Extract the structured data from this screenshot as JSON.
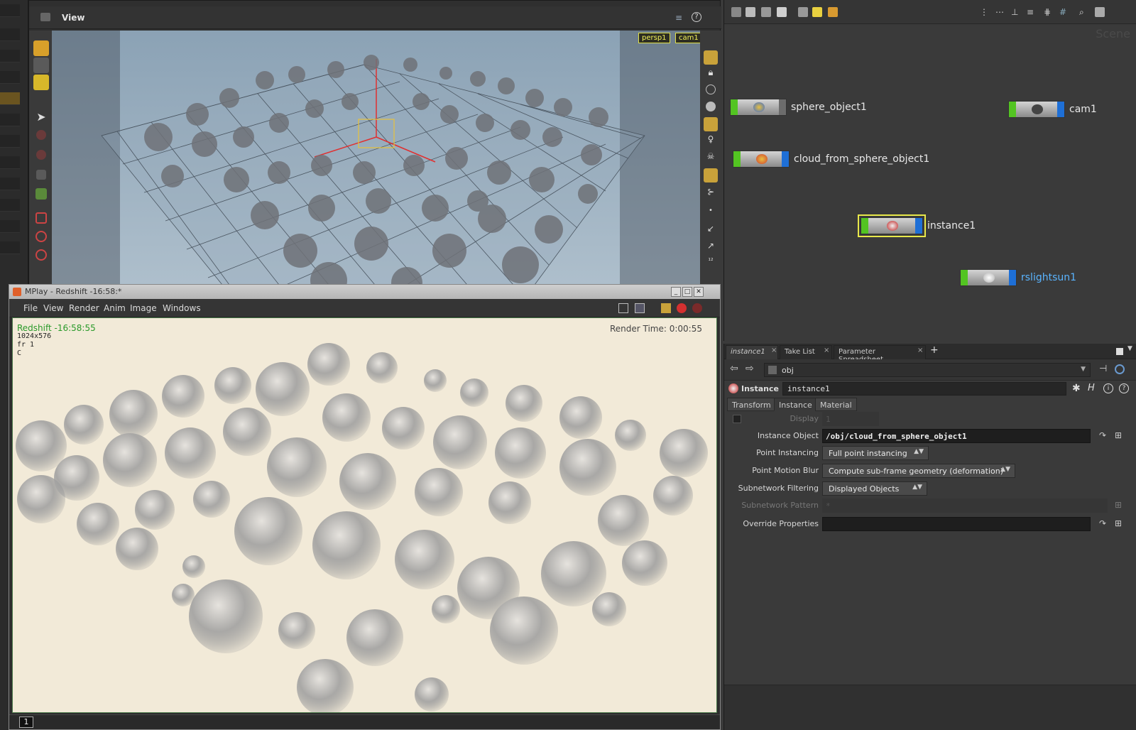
{
  "viewer": {
    "title": "View",
    "camera_menu": "persp1",
    "view_menu": "cam1"
  },
  "mplay": {
    "window_title": "MPlay - Redshift -16:58:*",
    "menus": [
      "File",
      "View",
      "Render",
      "Anim",
      "Image",
      "Windows"
    ],
    "render_name": "Redshift -16:58:55",
    "resolution": "1024x576",
    "frame_info": "fr 1",
    "channel": "C",
    "render_time": "Render Time: 0:00:55",
    "frame_number": "1",
    "window_buttons": [
      "_",
      "□",
      "✕"
    ]
  },
  "network": {
    "watermark": "Scene",
    "nodes": [
      {
        "name": "sphere_object1",
        "icon": "sphere-object-icon",
        "output_color": "#6c6c6c"
      },
      {
        "name": "cam1",
        "icon": "camera-icon",
        "output_color": "#1e6fd6"
      },
      {
        "name": "cloud_from_sphere_object1",
        "icon": "cloud-object-icon",
        "output_color": "#1e6fd6"
      },
      {
        "name": "instance1",
        "icon": "instance-icon",
        "output_color": "#1e6fd6",
        "selected": true
      },
      {
        "name": "rslightsun1",
        "icon": "sun-light-icon",
        "output_color": "#1e6fd6",
        "label_color": "#5ab4ff"
      }
    ]
  },
  "params": {
    "pane_tabs": [
      {
        "label": "instance1"
      },
      {
        "label": "Take List"
      },
      {
        "label": "Parameter Spreadsheet"
      }
    ],
    "tab_close": "×",
    "add_tab": "+",
    "path": "obj",
    "node_type": "Instance",
    "node_name": "instance1",
    "sub_tabs": [
      "Transform",
      "Instance",
      "Material"
    ],
    "active_sub_tab": "Instance",
    "display": {
      "label": "Display",
      "value": "1"
    },
    "instance_object": {
      "label": "Instance Object",
      "value": "/obj/cloud_from_sphere_object1"
    },
    "point_instancing": {
      "label": "Point Instancing",
      "value": "Full point instancing"
    },
    "point_motion_blur": {
      "label": "Point Motion Blur",
      "value": "Compute sub-frame geometry (deformation)"
    },
    "subnetwork_filtering": {
      "label": "Subnetwork Filtering",
      "value": "Displayed Objects"
    },
    "subnetwork_pattern": {
      "label": "Subnetwork Pattern",
      "value": "*"
    },
    "override_properties": {
      "label": "Override Properties",
      "value": ""
    }
  },
  "colors": {
    "accent_yellow": "#e8c23a",
    "node_green": "#53c422",
    "node_blue": "#1e6fd6",
    "render_bg": "#f2ead8"
  }
}
